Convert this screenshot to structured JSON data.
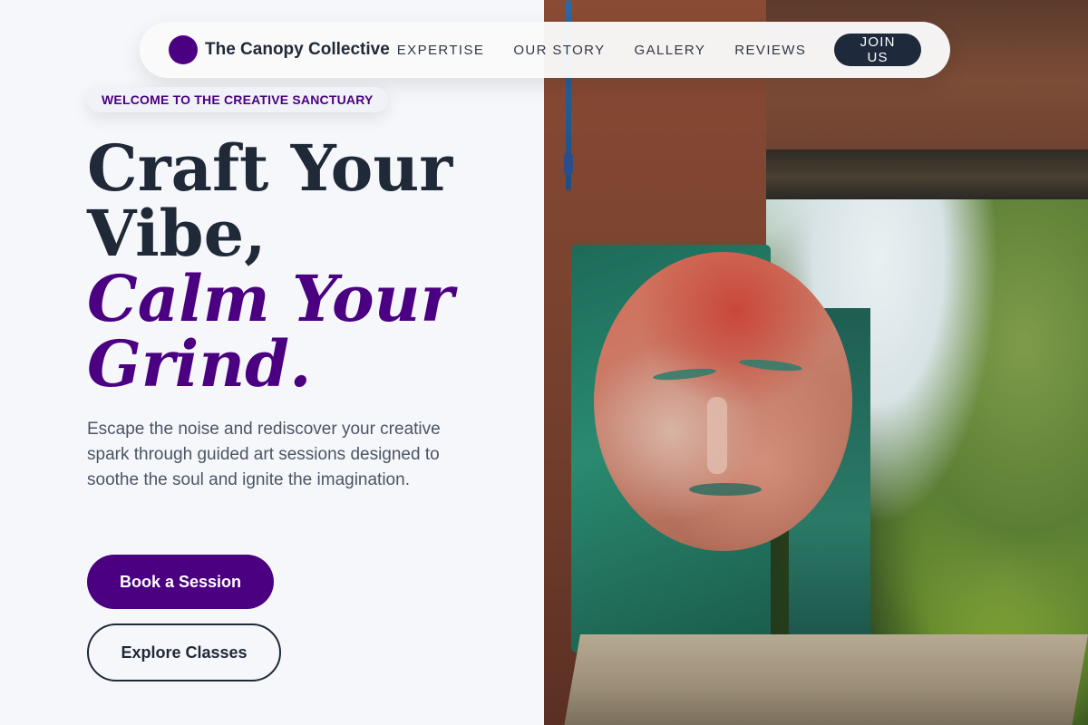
{
  "brand": {
    "name": "The Canopy Collective",
    "color": "#4b0082"
  },
  "nav": {
    "links": [
      "EXPERTISE",
      "OUR STORY",
      "GALLERY",
      "REVIEWS"
    ],
    "cta": "JOIN US"
  },
  "hero": {
    "badge": "WELCOME TO THE CREATIVE SANCTUARY",
    "headline": {
      "line1": "Craft Your",
      "line2": "Vibe,",
      "line3": "Calm Your",
      "line4": "Grind."
    },
    "subtext": "Escape the noise and rediscover your creative spark through guided art sessions designed to soothe the soul and ignite the imagination.",
    "primary_cta": "Book a Session",
    "secondary_cta": "Explore Classes"
  },
  "colors": {
    "accent": "#4b0082",
    "dark": "#1e293b"
  }
}
